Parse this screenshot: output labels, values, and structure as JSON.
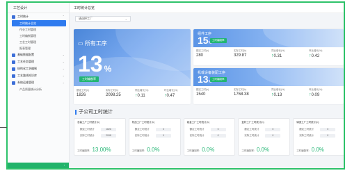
{
  "sidebar": {
    "logo": "工艺设计",
    "items": [
      {
        "type": "group",
        "label": "工时统计",
        "icon": "clock-icon"
      },
      {
        "type": "sub",
        "label": "工时统计总览",
        "active": true
      },
      {
        "type": "sub",
        "label": "作业工时管理"
      },
      {
        "type": "sub",
        "label": "工时编制管理"
      },
      {
        "type": "sub",
        "label": "工艺工时管理"
      },
      {
        "type": "sub",
        "label": "报表管理"
      },
      {
        "type": "group",
        "label": "基础数据配置",
        "icon": "database-icon"
      },
      {
        "type": "group",
        "label": "工艺任务管理",
        "icon": "task-icon"
      },
      {
        "type": "group",
        "label": "结构化工艺编制",
        "icon": "structure-icon"
      },
      {
        "type": "group",
        "label": "工艺路线知识库",
        "icon": "book-icon"
      },
      {
        "type": "group",
        "label": "系统运维管理",
        "icon": "gear-icon"
      },
      {
        "type": "sub",
        "label": "产品质量统计分析"
      }
    ],
    "collapse_icon": "‹"
  },
  "topbar": {
    "title": "工时统计总览"
  },
  "filter": {
    "value": "请选择工厂"
  },
  "big_card": {
    "title": "所有工序",
    "number": "13",
    "percent": "%",
    "tag": "工时编制率",
    "stats": [
      {
        "label": "额定工时(h)",
        "value": "1826"
      },
      {
        "label": "实际工时(h)",
        "value": "2098.25"
      },
      {
        "label": "同比增长(%)",
        "value": "0.11"
      },
      {
        "label": "环比增长(%)",
        "value": "0.47"
      }
    ]
  },
  "card_top": {
    "title": "组件工序",
    "number": "15",
    "percent": "%",
    "tag": "工时编制率",
    "stats": [
      {
        "label": "额定工时(h)",
        "value": "280"
      },
      {
        "label": "实际工时(h)",
        "value": "329.87"
      },
      {
        "label": "同比增长(%)",
        "value": "0.31"
      },
      {
        "label": "环比增长(%)",
        "value": "0.42"
      }
    ]
  },
  "card_bottom": {
    "title": "机载设备装配工序",
    "number": "13",
    "percent": "%",
    "tag": "工时编制率",
    "stats": [
      {
        "label": "额定工时(h)",
        "value": "1540"
      },
      {
        "label": "实际工时(h)",
        "value": "1768.38"
      },
      {
        "label": "同比增长(%)",
        "value": "0.13"
      },
      {
        "label": "环比增长(%)",
        "value": "0.09"
      }
    ]
  },
  "section": {
    "title": "子公司工时统计"
  },
  "sub_cards": [
    {
      "title": "总装工厂工时统计(h)",
      "k1": "额定工时统计",
      "v1": "1826",
      "k2": "实际工时统计",
      "v2": "2098",
      "ratio_label": "工时编制率:",
      "ratio": "13.00%"
    },
    {
      "title": "机加工厂工时统计(h)",
      "k1": "额定工时统计",
      "v1": "0",
      "k2": "实际工时统计",
      "v2": "0",
      "ratio_label": "工时编制率:",
      "ratio": "0.0%"
    },
    {
      "title": "钣金工厂工时统计(h)",
      "k1": "额定工时统计",
      "v1": "0",
      "k2": "实际工时统计",
      "v2": "0",
      "ratio_label": "工时编制率:",
      "ratio": "0.0%"
    },
    {
      "title": "复材工厂工时统计(h)",
      "k1": "额定工时统计",
      "v1": "0",
      "k2": "实际工时统计",
      "v2": "0",
      "ratio_label": "工时编制率:",
      "ratio": "0.0%"
    },
    {
      "title": "铸造工厂工时统计(h)",
      "k1": "额定工时统计",
      "v1": "0",
      "k2": "实际工时统计",
      "v2": "0",
      "ratio_label": "工时编制率:",
      "ratio": "0.0%"
    }
  ],
  "colors": {
    "accent": "#2f7bef",
    "green": "#22b573",
    "frame": "#2ec26a"
  }
}
